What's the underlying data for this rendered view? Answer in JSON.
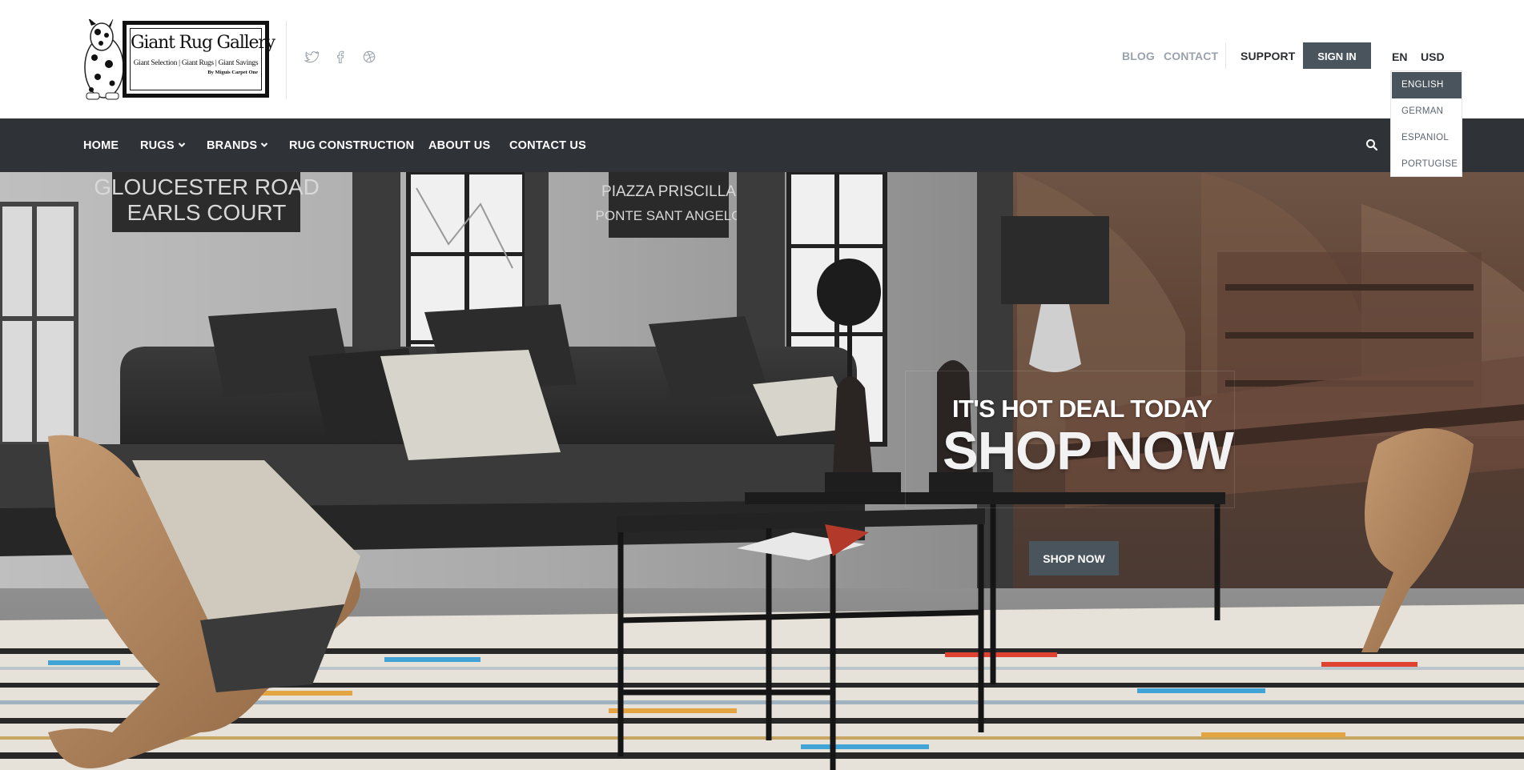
{
  "logo": {
    "title": "Giant Rug Gallery",
    "tagline": "Giant Selection | Giant Rugs | Giant Savings",
    "byline": "By Miguis Carpet One"
  },
  "social": {
    "icons": [
      "twitter-icon",
      "facebook-icon",
      "dribbble-icon"
    ]
  },
  "top_links": {
    "blog": "BLOG",
    "contact": "CONTACT",
    "support": "SUPPORT",
    "sign_in": "SIGN IN",
    "language": "EN",
    "currency": "USD"
  },
  "language_dropdown": {
    "options": [
      "ENGLISH",
      "GERMAN",
      "ESPANIOL",
      "PORTUGISE"
    ],
    "selected": "ENGLISH"
  },
  "nav": {
    "items": [
      {
        "label": "HOME",
        "has_dropdown": false
      },
      {
        "label": "RUGS",
        "has_dropdown": true
      },
      {
        "label": "BRANDS",
        "has_dropdown": true
      },
      {
        "label": "RUG CONSTRUCTION",
        "has_dropdown": false
      },
      {
        "label": "ABOUT US",
        "has_dropdown": false
      },
      {
        "label": "CONTACT US",
        "has_dropdown": false
      }
    ],
    "search_icon": "search-icon"
  },
  "hero": {
    "subtitle": "IT'S HOT DEAL TODAY",
    "title": "SHOP NOW",
    "button_label": "SHOP NOW",
    "wall_sign_left": [
      "GLOUCESTER ROAD",
      "EARLS COURT"
    ],
    "wall_sign_right": [
      "PIAZZA PRISCILLA",
      "PONTE SANT ANGELO"
    ]
  },
  "colors": {
    "nav_background": "#2f3338",
    "button_background": "#4a545c",
    "muted_link": "#9aa3ab",
    "dark_text": "#2b2f33"
  }
}
